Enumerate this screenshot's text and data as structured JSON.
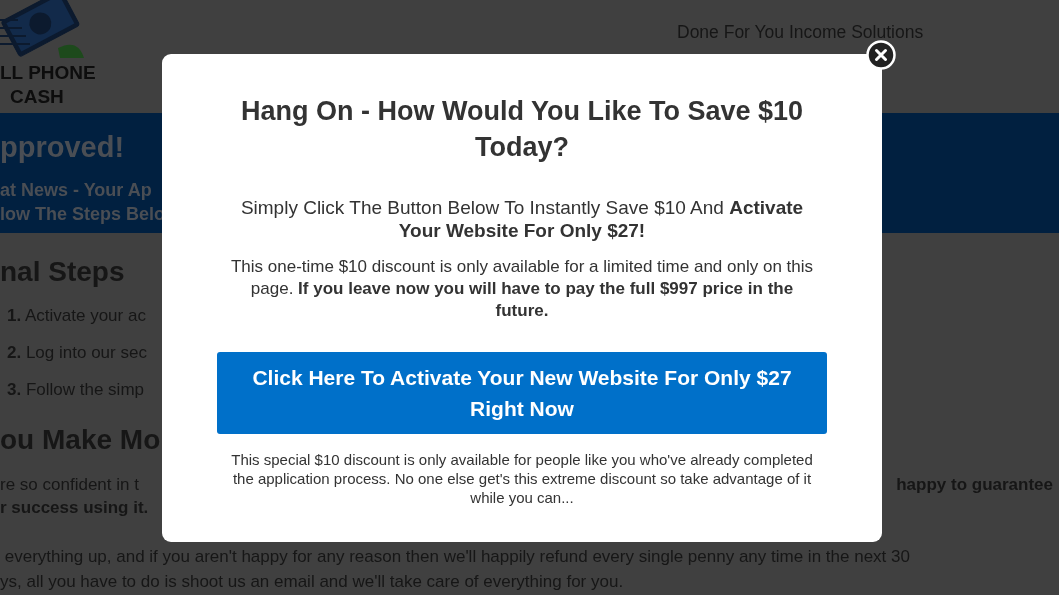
{
  "header": {
    "logo_lines": [
      "LL PHONE",
      "CASH"
    ],
    "tagline": "Done For You Income Solutions"
  },
  "banner": {
    "title": "pproved!",
    "lines": [
      "at News - Your Ap",
      "low The Steps Belo"
    ]
  },
  "steps_section": {
    "heading": "nal Steps",
    "steps": [
      {
        "number": "1.",
        "text": "Activate your ac"
      },
      {
        "number": "2.",
        "text": "Log into our sec"
      },
      {
        "number": "3.",
        "text": "Follow the simp"
      }
    ]
  },
  "guarantee_section": {
    "heading": "ou Make Mo",
    "lines": [
      [
        {
          "text": "re so confident in t",
          "bold": false
        },
        {
          "text": "happy to guarantee",
          "bold": true
        }
      ],
      [
        {
          "text": "r success using it.",
          "bold": true
        }
      ],
      [
        {
          "text": " everything up, and if you aren't happy for any reason then we'll happily refund every single penny any time in the next 30",
          "bold": false
        }
      ],
      [
        {
          "text": "ys, all you have to do is shoot us an email and we'll take care of everything for you.",
          "bold": false
        }
      ]
    ]
  },
  "modal": {
    "title": "Hang On - How Would You Like To Save $10 Today?",
    "subtitle": "Simply Click The Button Below To Instantly Save $10 And **Activate Your Website For Only $27!**",
    "body": "This one-time $10 discount is only available for a limited time and only on this page. **If you leave now you will have to pay the full $997 price in the future.**",
    "button": "Click Here To Activate Your New Website For Only $27 Right Now",
    "note": "This special $10 discount is only available for people like you who've already completed the application process. No one else get's this extreme discount so take advantage of it while you can..."
  }
}
